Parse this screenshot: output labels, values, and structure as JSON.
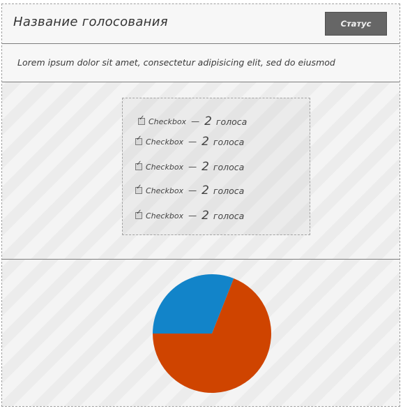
{
  "poll": {
    "title": "Название голосования",
    "status_label": "Статус",
    "description": "Lorem ipsum dolor sit amet, consectetur adipisicing elit, sed do eiusmod"
  },
  "options": [
    {
      "label": "Checkbox",
      "separator": "—",
      "count": "2",
      "unit": "голоса",
      "checked": true
    },
    {
      "label": "Checkbox",
      "separator": "—",
      "count": "2",
      "unit": "голоса",
      "checked": true
    },
    {
      "label": "Checkbox",
      "separator": "—",
      "count": "2",
      "unit": "голоса",
      "checked": true
    },
    {
      "label": "Checkbox",
      "separator": "—",
      "count": "2",
      "unit": "голоса",
      "checked": true
    },
    {
      "label": "Checkbox",
      "separator": "—",
      "count": "2",
      "unit": "голоса",
      "checked": true
    }
  ],
  "chart_data": {
    "type": "pie",
    "slices": [
      {
        "value": 0.31,
        "color": "#1284c9"
      },
      {
        "value": 0.69,
        "color": "#cf4400"
      }
    ],
    "start_angle_deg": -180
  }
}
